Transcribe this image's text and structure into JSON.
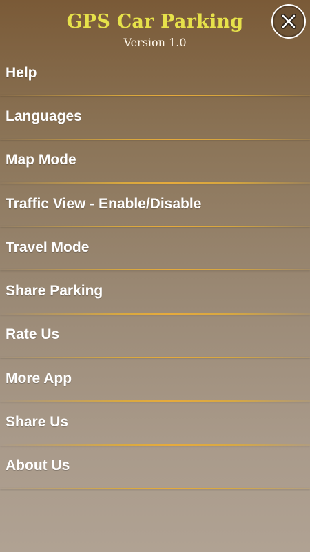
{
  "header": {
    "title": "GPS Car Parking",
    "version": "Version 1.0"
  },
  "close_button": {
    "icon": "close-icon"
  },
  "menu": {
    "items": [
      {
        "label": "Help"
      },
      {
        "label": "Languages"
      },
      {
        "label": "Map Mode"
      },
      {
        "label": "Traffic View - Enable/Disable"
      },
      {
        "label": "Travel Mode"
      },
      {
        "label": "Share Parking"
      },
      {
        "label": "Rate Us"
      },
      {
        "label": "More App"
      },
      {
        "label": "Share Us"
      },
      {
        "label": "About Us"
      }
    ]
  },
  "colors": {
    "title": "#e6e14a",
    "text": "#ffffff",
    "divider": "#e6aa3c",
    "background_top": "#7a5a37",
    "background_bottom": "#b0a293"
  }
}
